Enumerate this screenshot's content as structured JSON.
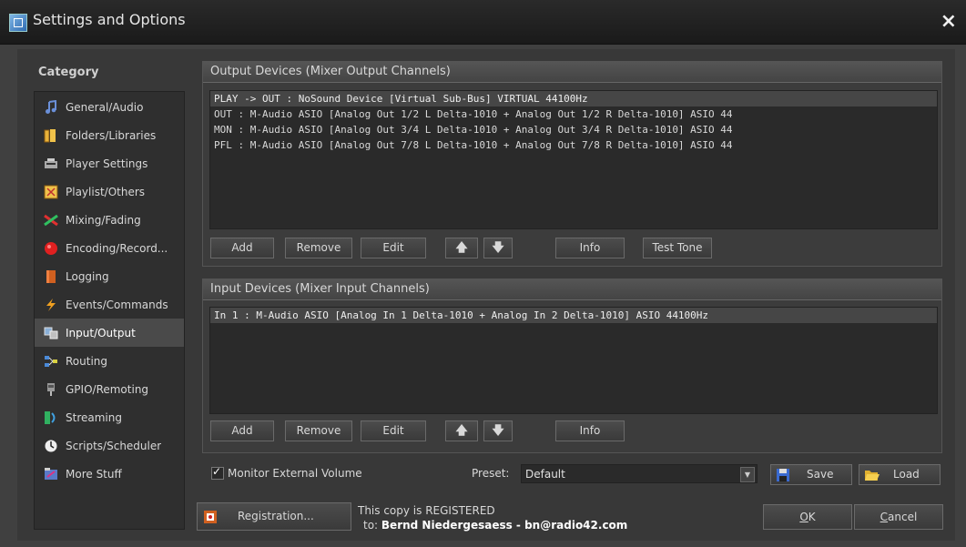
{
  "window": {
    "title": "Settings and Options",
    "close_icon": "×"
  },
  "sidebar": {
    "heading": "Category",
    "items": [
      {
        "label": "General/Audio",
        "icon": "music-note-icon"
      },
      {
        "label": "Folders/Libraries",
        "icon": "books-icon"
      },
      {
        "label": "Player Settings",
        "icon": "player-icon"
      },
      {
        "label": "Playlist/Others",
        "icon": "playlist-icon"
      },
      {
        "label": "Mixing/Fading",
        "icon": "mixing-icon"
      },
      {
        "label": "Encoding/Record...",
        "icon": "record-icon"
      },
      {
        "label": "Logging",
        "icon": "logging-icon"
      },
      {
        "label": "Events/Commands",
        "icon": "lightning-icon"
      },
      {
        "label": "Input/Output",
        "icon": "input-output-icon"
      },
      {
        "label": "Routing",
        "icon": "routing-icon"
      },
      {
        "label": "GPIO/Remoting",
        "icon": "gpio-icon"
      },
      {
        "label": "Streaming",
        "icon": "streaming-icon"
      },
      {
        "label": "Scripts/Scheduler",
        "icon": "clock-icon"
      },
      {
        "label": "More Stuff",
        "icon": "more-stuff-icon"
      }
    ],
    "selected_index": 8
  },
  "output": {
    "title": "Output Devices (Mixer Output Channels)",
    "rows": [
      "PLAY  -> OUT  : NoSound Device [Virtual Sub-Bus] VIRTUAL 44100Hz",
      "OUT  : M-Audio ASIO [Analog Out 1/2 L Delta-1010 + Analog Out 1/2 R Delta-1010] ASIO 44",
      "MON  : M-Audio ASIO [Analog Out 3/4 L Delta-1010 + Analog Out 3/4 R Delta-1010] ASIO 44",
      "PFL  : M-Audio ASIO [Analog Out 7/8 L Delta-1010 + Analog Out 7/8 R Delta-1010] ASIO 44"
    ],
    "buttons": {
      "add": "Add",
      "remove": "Remove",
      "edit": "Edit",
      "up": "🡅",
      "down": "🡇",
      "info": "Info",
      "test_tone": "Test Tone"
    }
  },
  "input": {
    "title": "Input Devices (Mixer Input Channels)",
    "rows": [
      "In 1 : M-Audio ASIO [Analog In 1 Delta-1010 + Analog In 2 Delta-1010] ASIO 44100Hz"
    ],
    "buttons": {
      "add": "Add",
      "remove": "Remove",
      "edit": "Edit",
      "up": "🡅",
      "down": "🡇",
      "info": "Info"
    }
  },
  "monitor": {
    "label": "Monitor External Volume",
    "checked": true
  },
  "preset": {
    "label": "Preset:",
    "value": "Default",
    "save": "Save",
    "load": "Load"
  },
  "registration": {
    "button": "Registration...",
    "line1": "This copy is REGISTERED",
    "line2_prefix": "to: ",
    "line2_name": "Bernd Niedergesaess - bn@radio42.com"
  },
  "footer": {
    "ok_u": "O",
    "ok_rest": "K",
    "cancel_u": "C",
    "cancel_rest": "ancel"
  }
}
